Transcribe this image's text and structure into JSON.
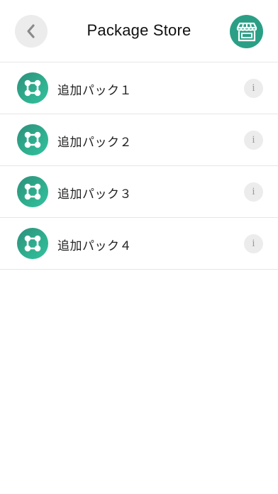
{
  "header": {
    "title": "Package Store",
    "back_icon": "chevron-left-icon",
    "store_icon": "storefront-icon",
    "accent_color": "#2a9f86"
  },
  "packs": [
    {
      "label": "追加パック１",
      "icon": "nodes-icon",
      "info": "i"
    },
    {
      "label": "追加パック２",
      "icon": "nodes-icon",
      "info": "i"
    },
    {
      "label": "追加パック３",
      "icon": "nodes-icon",
      "info": "i"
    },
    {
      "label": "追加パック４",
      "icon": "nodes-icon",
      "info": "i"
    }
  ]
}
